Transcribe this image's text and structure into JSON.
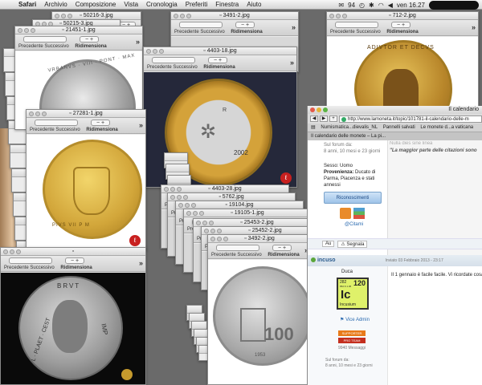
{
  "menubar": {
    "apple_icon": "apple-icon",
    "items": [
      "Safari",
      "Archivio",
      "Composizione",
      "Vista",
      "Cronologia",
      "Preferiti",
      "Finestra",
      "Aiuto"
    ],
    "battery": "94",
    "clock": "ven 16.27"
  },
  "toolbar_labels": {
    "prev": "Precedente",
    "next": "Successivo",
    "resize": "Ridimensiona"
  },
  "windows": [
    {
      "title": "50216-3.jpg"
    },
    {
      "title": "50215-3.jpg"
    },
    {
      "title": "21451-1.jpg"
    },
    {
      "title": "3491-2.jpg"
    },
    {
      "title": "4403-18.jpg"
    },
    {
      "title": "712-2.jpg"
    },
    {
      "title": "27281-1.jpg"
    },
    {
      "title": "4403-28.jpg"
    },
    {
      "title": "5762.jpg"
    },
    {
      "title": "19104.jpg"
    },
    {
      "title": "19105-1.jpg"
    },
    {
      "title": "25453-2.jpg"
    },
    {
      "title": "25452-2.jpg"
    },
    {
      "title": "3492-2.jpg"
    }
  ],
  "coins": {
    "papal_top_text": "VRBANVS · VIII · PONT · MAX",
    "euro_year": "2002",
    "euro_letter": "R",
    "gold_papal_text": "PIVS VII P M",
    "madonna_text": "ADIVTOR ET DECVS",
    "roman_text_top": "BRVT",
    "roman_text_left": "L · PLAET · CEST",
    "roman_text_right": "IMP",
    "silver_value": "100",
    "silver_year": "1953",
    "watermark": "lamoneta-logo"
  },
  "browser": {
    "title": "Il calendario",
    "url": "http://www.lamoneta.it/topic/101781-il-calendario-delle-m",
    "bookmarks": [
      "Numismatica...dievalis_NL",
      "Pannelli salvati",
      "Le monete d...a vaticana"
    ],
    "tab": "Il calendario delle monete – La pi...",
    "profile_top": {
      "forum_since_label": "Sul forum da:",
      "forum_since": "8 anni, 10 mesi e 23 giorni",
      "sex": "Sesso: Uomo",
      "origin_label": "Provenienza:",
      "origin": "Ducato di Parma, Piacenza e stati annessi",
      "awards_button": "Riconoscimenti",
      "citations": "@Citami",
      "quote": "\"La maggior parte delle citazioni sono",
      "quote_small": "Nulla dies sine lineа"
    },
    "actions": [
      "Au",
      "Segnala"
    ],
    "post": {
      "author": "incuso",
      "date": "Inviato 03 Febbraio 2013 - 23:17",
      "role": "Duca",
      "element_num": "282",
      "element_sym": "Ic",
      "element_name": "Incusium",
      "element_mass": "120",
      "element_small": "652.6  1.36",
      "vice_admin": "Vice Admin",
      "badge1": "SUPPORTER",
      "badge2": "PRO TEAM",
      "messages": "9940 Messaggi",
      "body": "Il 1 gennaio è facile facile. Vi ricordate cosa è",
      "forum_since_label": "Sul forum da:",
      "forum_since": "8 anni, 10 mesi e 23 giorni"
    }
  },
  "colors": {
    "gold": "#c9a33b",
    "silver": "#b9b9b9",
    "accent": "#2a6ab0"
  }
}
